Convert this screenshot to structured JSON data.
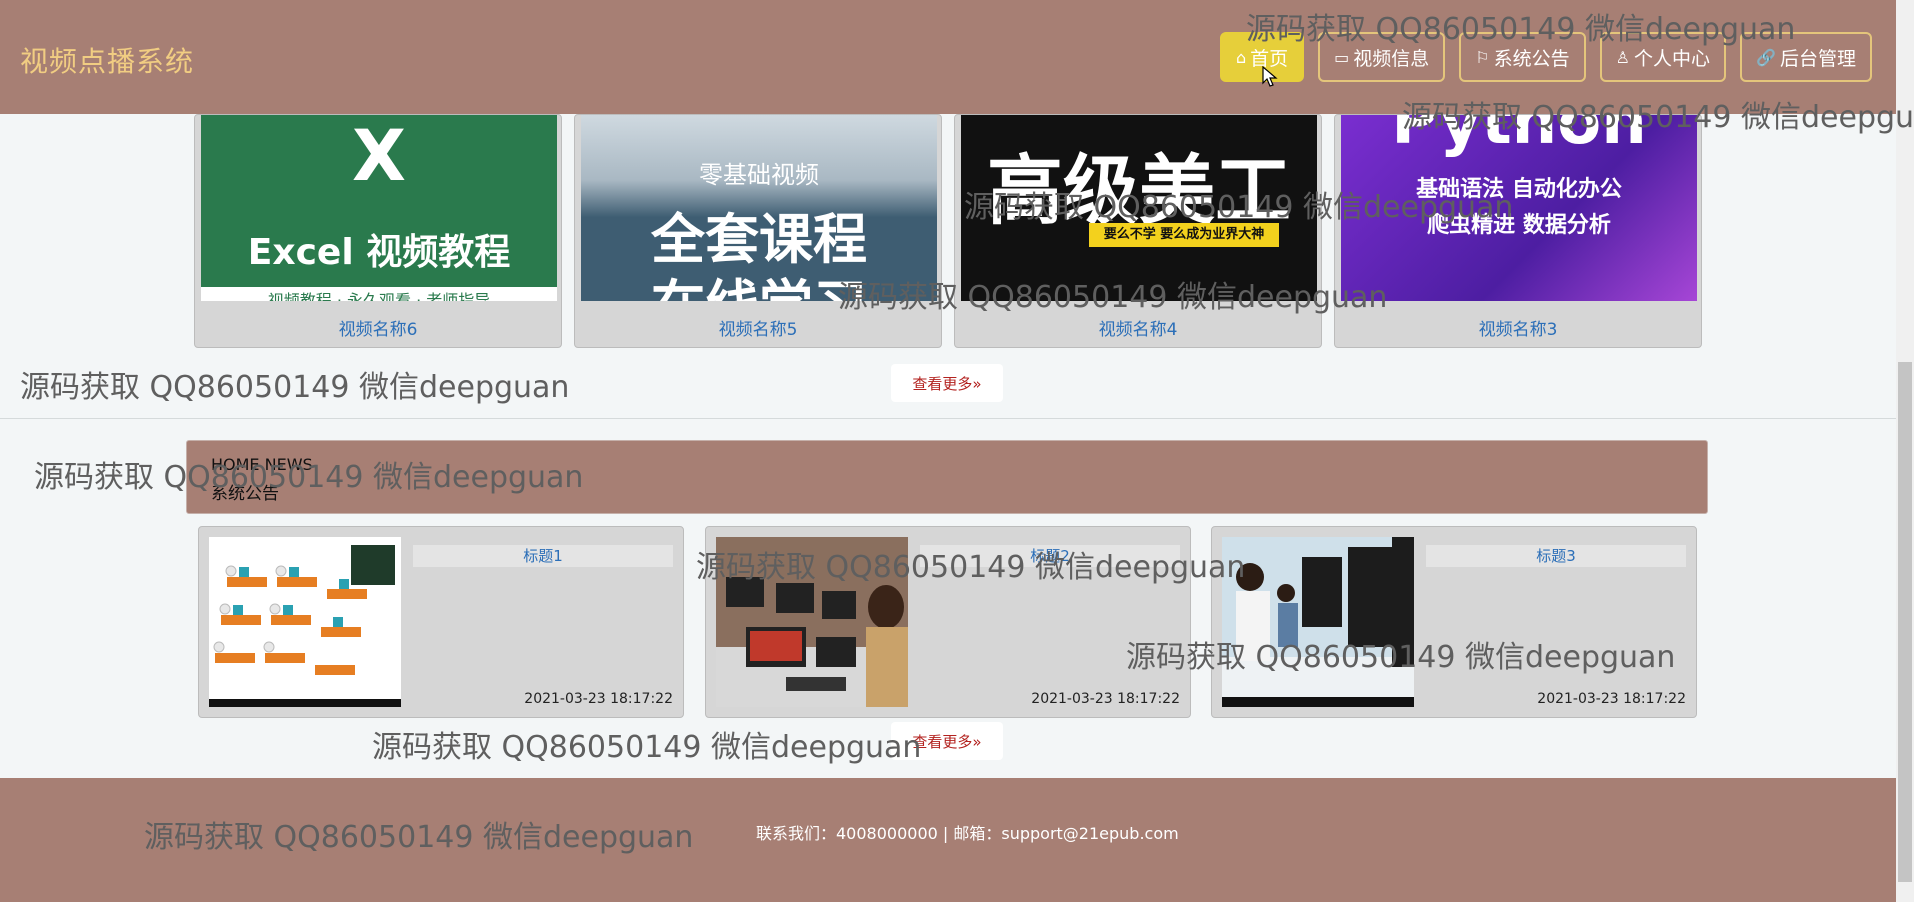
{
  "header": {
    "brand": "视频点播系统",
    "nav": [
      {
        "icon": "⌂",
        "label": "首页"
      },
      {
        "icon": "▭",
        "label": "视频信息"
      },
      {
        "icon": "⚐",
        "label": "系统公告"
      },
      {
        "icon": "♙",
        "label": "个人中心"
      },
      {
        "icon": "🔗",
        "label": "后台管理"
      }
    ]
  },
  "videos": {
    "items": [
      {
        "caption": "视频名称6",
        "thumb_main": "Excel 视频教程",
        "thumb_sub": "视频教程 · 永久观看 · 老师指导",
        "thumb_top": "X",
        "bg": "#2a7a4d"
      },
      {
        "caption": "视频名称5",
        "thumb_main": "全套课程",
        "thumb_sub": "在线学习",
        "thumb_top": "零基础视频",
        "bg": "#3e5d72"
      },
      {
        "caption": "视频名称4",
        "thumb_main": "高级美工",
        "thumb_sub": "要么不学 要么成为业界大神",
        "thumb_top": "",
        "bg": "#111111"
      },
      {
        "caption": "视频名称3",
        "thumb_main": "Python",
        "thumb_sub": "基础语法  自动化办公",
        "thumb_top": "爬虫精进  数据分析",
        "bg": "#5a2ab0"
      }
    ],
    "more_label": "查看更多»"
  },
  "news": {
    "heading_en": "HOME NEWS",
    "heading_cn": "系统公告",
    "items": [
      {
        "title": "标题1",
        "date": "2021-03-23 18:17:22"
      },
      {
        "title": "标题2",
        "date": "2021-03-23 18:17:22"
      },
      {
        "title": "标题3",
        "date": "2021-03-23 18:17:22"
      }
    ],
    "more_label": "查看更多»"
  },
  "footer": {
    "contact": "联系我们：4008000000 | 邮箱：support@21epub.com"
  },
  "watermark": "源码获取 QQ86050149 微信deepguan",
  "colors": {
    "header_bg": "#a77f74",
    "brand": "#f1cd82",
    "active_nav": "#e6cf3a",
    "link": "#2c6fb8",
    "more_text": "#b3221f"
  }
}
